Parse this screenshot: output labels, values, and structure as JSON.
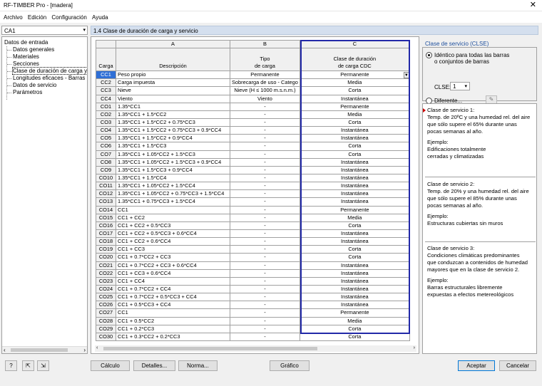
{
  "window": {
    "title": "RF-TIMBER Pro - [madera]",
    "close": "✕"
  },
  "menu": [
    "Archivo",
    "Edición",
    "Configuración",
    "Ayuda"
  ],
  "case_select": {
    "value": "CA1"
  },
  "nav": {
    "root": "Datos de entrada",
    "items": [
      "Datos generales",
      "Materiales",
      "Secciones",
      "Clase de duración de carga y s",
      "Longitudes eficaces - Barras",
      "Datos de servicio",
      "Parámetros"
    ],
    "selected_index": 3
  },
  "panel_title": "1.4 Clase de duración de carga y servicio",
  "table": {
    "col_letters": [
      "A",
      "B",
      "C"
    ],
    "row_header": "Carga",
    "col_headers": [
      "Descripción",
      "Tipo\nde carga",
      "Clase de duración\nde carga CDC"
    ],
    "rows": [
      [
        "CC1",
        "Peso propio",
        "Permanente",
        "Permanente"
      ],
      [
        "CC2",
        "Carga impuesta",
        "Sobrecarga de uso - Catego",
        "Media"
      ],
      [
        "CC3",
        "Nieve",
        "Nieve (H ≤ 1000 m.s.n.m.)",
        "Corta"
      ],
      [
        "CC4",
        "Viento",
        "Viento",
        "Instantánea"
      ],
      [
        "CO1",
        "1.35*CC1",
        "-",
        "Permanente"
      ],
      [
        "CO2",
        "1.35*CC1 + 1.5*CC2",
        "-",
        "Media"
      ],
      [
        "CO3",
        "1.35*CC1 + 1.5*CC2 + 0.75*CC3",
        "-",
        "Corta"
      ],
      [
        "CO4",
        "1.35*CC1 + 1.5*CC2 + 0.75*CC3 + 0.9*CC4",
        "-",
        "Instantánea"
      ],
      [
        "CO5",
        "1.35*CC1 + 1.5*CC2 + 0.9*CC4",
        "-",
        "Instantánea"
      ],
      [
        "CO6",
        "1.35*CC1 + 1.5*CC3",
        "-",
        "Corta"
      ],
      [
        "CO7",
        "1.35*CC1 + 1.05*CC2 + 1.5*CC3",
        "-",
        "Corta"
      ],
      [
        "CO8",
        "1.35*CC1 + 1.05*CC2 + 1.5*CC3 + 0.9*CC4",
        "-",
        "Instantánea"
      ],
      [
        "CO9",
        "1.35*CC1 + 1.5*CC3 + 0.9*CC4",
        "-",
        "Instantánea"
      ],
      [
        "CO10",
        "1.35*CC1 + 1.5*CC4",
        "-",
        "Instantánea"
      ],
      [
        "CO11",
        "1.35*CC1 + 1.05*CC2 + 1.5*CC4",
        "-",
        "Instantánea"
      ],
      [
        "CO12",
        "1.35*CC1 + 1.05*CC2 + 0.75*CC3 + 1.5*CC4",
        "-",
        "Instantánea"
      ],
      [
        "CO13",
        "1.35*CC1 + 0.75*CC3 + 1.5*CC4",
        "-",
        "Instantánea"
      ],
      [
        "CO14",
        "CC1",
        "-",
        "Permanente"
      ],
      [
        "CO15",
        "CC1 + CC2",
        "-",
        "Media"
      ],
      [
        "CO16",
        "CC1 + CC2 + 0.5*CC3",
        "-",
        "Corta"
      ],
      [
        "CO17",
        "CC1 + CC2 + 0.5*CC3 + 0.6*CC4",
        "-",
        "Instantánea"
      ],
      [
        "CO18",
        "CC1 + CC2 + 0.6*CC4",
        "-",
        "Instantánea"
      ],
      [
        "CO19",
        "CC1 + CC3",
        "-",
        "Corta"
      ],
      [
        "CO20",
        "CC1 + 0.7*CC2 + CC3",
        "-",
        "Corta"
      ],
      [
        "CO21",
        "CC1 + 0.7*CC2 + CC3 + 0.6*CC4",
        "-",
        "Instantánea"
      ],
      [
        "CO22",
        "CC1 + CC3 + 0.6*CC4",
        "-",
        "Instantánea"
      ],
      [
        "CO23",
        "CC1 + CC4",
        "-",
        "Instantánea"
      ],
      [
        "CO24",
        "CC1 + 0.7*CC2 + CC4",
        "-",
        "Instantánea"
      ],
      [
        "CO25",
        "CC1 + 0.7*CC2 + 0.5*CC3 + CC4",
        "-",
        "Instantánea"
      ],
      [
        "CO26",
        "CC1 + 0.5*CC3 + CC4",
        "-",
        "Instantánea"
      ],
      [
        "CO27",
        "CC1",
        "-",
        "Permanente"
      ],
      [
        "CO28",
        "CC1 + 0.5*CC2",
        "-",
        "Media"
      ],
      [
        "CO29",
        "CC1 + 0.2*CC3",
        "-",
        "Corta"
      ],
      [
        "CO30",
        "CC1 + 0.3*CC2 + 0.2*CC3",
        "-",
        "Corta"
      ]
    ]
  },
  "service": {
    "title": "Clase de servicio (CLSE)",
    "option1": "Idéntico para todas las barras\no conjuntos de barras",
    "clse_label": "CLSE:",
    "clse_value": "1",
    "option2": "Diferente..."
  },
  "info": [
    {
      "head": "Clase de servicio 1:",
      "body": "Temp. de 20ºC y una humedad rel. del aire\nque sólo supere el 65% durante unas\npocas semanas al año.",
      "ex_label": "Ejemplo:",
      "example": "Edificaciones totalmente\ncerradas y climatizadas"
    },
    {
      "head": "Clase de servicio 2:",
      "body": "Temp. de 20% y una humedad rel. del aire\nque sólo supere el 85% durante unas\npocas semanas al año.",
      "ex_label": "Ejemplo:",
      "example": "Estructuras cubiertas sin muros"
    },
    {
      "head": "Clase de servicio 3:",
      "body": "Condiciones climáticas predominantes\nque conduzcan a contenidos de humedad\nmayores que en la clase de servicio 2.",
      "ex_label": "Ejemplo:",
      "example": "Barras estructurales libremente\nexpuestas a efectos metereológicos"
    }
  ],
  "buttons": {
    "calc": "Cálculo",
    "details": "Detalles...",
    "norma": "Norma...",
    "graph": "Gráfico",
    "accept": "Aceptar",
    "cancel": "Cancelar"
  }
}
